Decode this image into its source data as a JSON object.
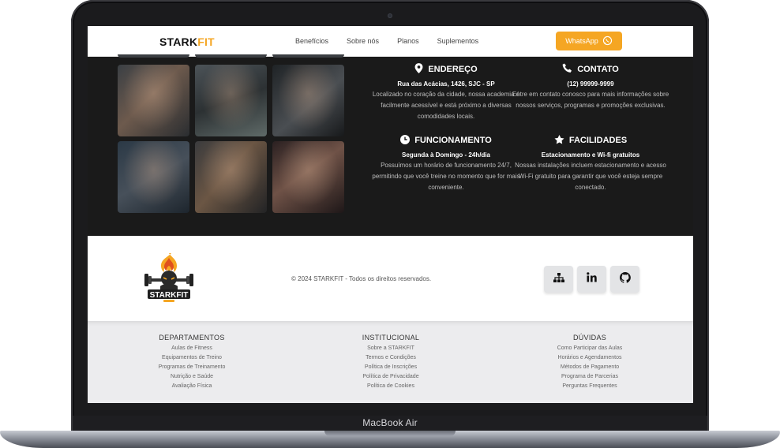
{
  "device": {
    "model_label": "MacBook Air"
  },
  "navbar": {
    "brand_main": "STARK",
    "brand_accent": "FIT",
    "links": [
      "Benefícios",
      "Sobre nós",
      "Planos",
      "Suplementos"
    ],
    "whatsapp_label": "WhatsApp"
  },
  "info": {
    "endereco": {
      "title": "ENDEREÇO",
      "subtitle": "Rua das Acácias, 1426, SJC - SP",
      "description": "Localizado no coração da cidade, nossa academia é facilmente acessível e está próximo a diversas comodidades locais."
    },
    "contato": {
      "title": "CONTATO",
      "subtitle": "(12) 99999-9999",
      "description": "Entre em contato conosco para mais informações sobre nossos serviços, programas e promoções exclusivas."
    },
    "funcionamento": {
      "title": "FUNCIONAMENTO",
      "subtitle": "Segunda à Domingo - 24h/dia",
      "description": "Possuímos um horário de funcionamento 24/7, permitindo que você treine no momento que for mais conveniente."
    },
    "facilidades": {
      "title": "FACILIDADES",
      "subtitle": "Estacionamento e Wi-fi gratuitos",
      "description": "Nossas instalações incluem estacionamento e acesso Wi-Fi gratuito para garantir que você esteja sempre conectado."
    }
  },
  "footer": {
    "logo_text": "STARKFIT",
    "copyright": "© 2024 STARKFIT - Todos os direitos reservados.",
    "social_icons": [
      "sitemap-icon",
      "linkedin-icon",
      "github-icon"
    ],
    "columns": [
      {
        "title": "DEPARTAMENTOS",
        "links": [
          "Aulas de Fitness",
          "Equipamentos de Treino",
          "Programas de Treinamento",
          "Nutrição e Saúde",
          "Avaliação Física"
        ]
      },
      {
        "title": "INSTITUCIONAL",
        "links": [
          "Sobre a STARKFIT",
          "Termos e Condições",
          "Política de Inscrições",
          "Política de Privacidade",
          "Política de Cookies"
        ]
      },
      {
        "title": "DÚVIDAS",
        "links": [
          "Como Participar das Aulas",
          "Horários e Agendamentos",
          "Métodos de Pagamento",
          "Programa de Parcerias",
          "Perguntas Frequentes"
        ]
      }
    ]
  },
  "colors": {
    "accent": "#f5a623",
    "dark_bg": "#1a1a1a",
    "footer_gray": "#ececee"
  }
}
